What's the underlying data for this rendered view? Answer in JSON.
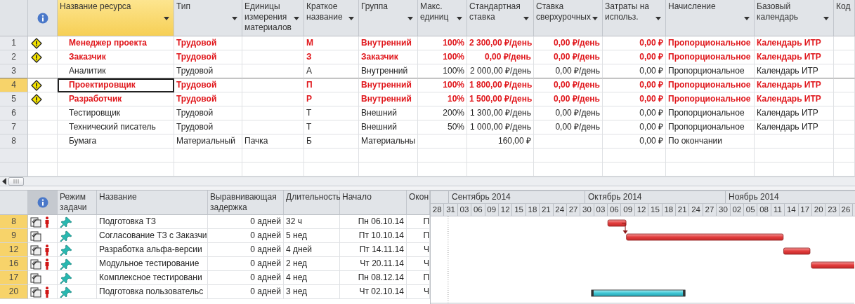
{
  "resource_sheet": {
    "columns": [
      {
        "label": "Название ресурса",
        "selected": true
      },
      {
        "label": "Тип",
        "selected": false
      },
      {
        "label": "Единицы измерения материалов",
        "selected": false
      },
      {
        "label": "Краткое название",
        "selected": false
      },
      {
        "label": "Группа",
        "selected": false
      },
      {
        "label": "Макс. единиц",
        "selected": false
      },
      {
        "label": "Стандартная ставка",
        "selected": false
      },
      {
        "label": "Ставка сверхурочных",
        "selected": false
      },
      {
        "label": "Затраты на использ.",
        "selected": false
      },
      {
        "label": "Начисление",
        "selected": false
      },
      {
        "label": "Базовый календарь",
        "selected": false
      },
      {
        "label": "Код",
        "selected": false
      }
    ],
    "rows": [
      {
        "id": "1",
        "overallocated": true,
        "selected": false,
        "name": "Менеджер проекта",
        "type": "Трудовой",
        "short": "М",
        "group": "Внутренний",
        "max_units": "100%",
        "std_rate": "2 300,00 ₽/день",
        "ovt_rate": "0,00 ₽/день",
        "cost_per_use": "0,00 ₽",
        "accrual": "Пропорциональное",
        "calendar": "Календарь ИТР"
      },
      {
        "id": "2",
        "overallocated": true,
        "selected": false,
        "name": "Заказчик",
        "type": "Трудовой",
        "short": "З",
        "group": "Заказчик",
        "max_units": "100%",
        "std_rate": "0,00 ₽/день",
        "ovt_rate": "0,00 ₽/день",
        "cost_per_use": "0,00 ₽",
        "accrual": "Пропорциональное",
        "calendar": "Календарь ИТР"
      },
      {
        "id": "3",
        "overallocated": false,
        "selected": false,
        "name": "Аналитик",
        "type": "Трудовой",
        "short": "А",
        "group": "Внутренний",
        "max_units": "100%",
        "std_rate": "2 000,00 ₽/день",
        "ovt_rate": "0,00 ₽/день",
        "cost_per_use": "0,00 ₽",
        "accrual": "Пропорциональное",
        "calendar": "Календарь ИТР"
      },
      {
        "id": "4",
        "overallocated": true,
        "selected": true,
        "name": "Проектировщик",
        "type": "Трудовой",
        "short": "П",
        "group": "Внутренний",
        "max_units": "100%",
        "std_rate": "1 800,00 ₽/день",
        "ovt_rate": "0,00 ₽/день",
        "cost_per_use": "0,00 ₽",
        "accrual": "Пропорциональное",
        "calendar": "Календарь ИТР"
      },
      {
        "id": "5",
        "overallocated": true,
        "selected": false,
        "name": "Разработчик",
        "type": "Трудовой",
        "short": "Р",
        "group": "Внутренний",
        "max_units": "10%",
        "std_rate": "1 500,00 ₽/день",
        "ovt_rate": "0,00 ₽/день",
        "cost_per_use": "0,00 ₽",
        "accrual": "Пропорциональное",
        "calendar": "Календарь ИТР"
      },
      {
        "id": "6",
        "overallocated": false,
        "selected": false,
        "name": "Тестировщик",
        "type": "Трудовой",
        "short": "Т",
        "group": "Внешний",
        "max_units": "200%",
        "std_rate": "1 300,00 ₽/день",
        "ovt_rate": "0,00 ₽/день",
        "cost_per_use": "0,00 ₽",
        "accrual": "Пропорциональное",
        "calendar": "Календарь ИТР"
      },
      {
        "id": "7",
        "overallocated": false,
        "selected": false,
        "name": "Технический писатель",
        "type": "Трудовой",
        "short": "Т",
        "group": "Внешний",
        "max_units": "50%",
        "std_rate": "1 000,00 ₽/день",
        "ovt_rate": "0,00 ₽/день",
        "cost_per_use": "0,00 ₽",
        "accrual": "Пропорциональное",
        "calendar": "Календарь ИТР"
      },
      {
        "id": "8",
        "overallocated": false,
        "selected": false,
        "name": "Бумага",
        "type": "Материальный",
        "units": "Пачка",
        "short": "Б",
        "group": "Материальны",
        "std_rate": "160,00 ₽",
        "cost_per_use": "0,00 ₽",
        "accrual": "По окончании"
      }
    ]
  },
  "task_table": {
    "columns": [
      "Режим задачи",
      "Название",
      "Выравнивающая задержка",
      "Длительность",
      "Начало",
      "Окон"
    ],
    "rows": [
      {
        "id": "8",
        "has_resource": true,
        "name": "Подготовка ТЗ",
        "delay": "0 адней",
        "duration": "32 ч",
        "start": "Пн 06.10.14",
        "finish": "П",
        "critical": true
      },
      {
        "id": "9",
        "has_resource": false,
        "name": "Согласование ТЗ с Заказчи",
        "delay": "0 адней",
        "duration": "5 нед",
        "start": "Пт 10.10.14",
        "finish": "П",
        "critical": true
      },
      {
        "id": "12",
        "has_resource": true,
        "name": "Разработка альфа-версии",
        "delay": "0 адней",
        "duration": "4 дней",
        "start": "Пт 14.11.14",
        "finish": "Ч",
        "critical": true
      },
      {
        "id": "16",
        "has_resource": true,
        "name": "Модульное тестирование",
        "delay": "0 адней",
        "duration": "2 нед",
        "start": "Чт 20.11.14",
        "finish": "Ч",
        "critical": true
      },
      {
        "id": "17",
        "has_resource": false,
        "name": "Комплексное тестировани",
        "delay": "0 адней",
        "duration": "4 нед",
        "start": "Пн 08.12.14",
        "finish": "П"
      },
      {
        "id": "20",
        "has_resource": true,
        "name": "Подготовка пользовательс",
        "delay": "0 адней",
        "duration": "3 нед",
        "start": "Чт 02.10.14",
        "finish": "Ч",
        "critical": false
      }
    ]
  },
  "gantt": {
    "months": [
      "Сентябрь 2014",
      "Октябрь 2014",
      "Ноябрь 2014"
    ],
    "days": [
      "28",
      "31",
      "03",
      "06",
      "09",
      "12",
      "15",
      "18",
      "21",
      "24",
      "27",
      "30",
      "03",
      "06",
      "09",
      "12",
      "15",
      "18",
      "21",
      "24",
      "27",
      "30",
      "02",
      "05",
      "08",
      "11",
      "14",
      "17",
      "20",
      "23",
      "26"
    ]
  }
}
